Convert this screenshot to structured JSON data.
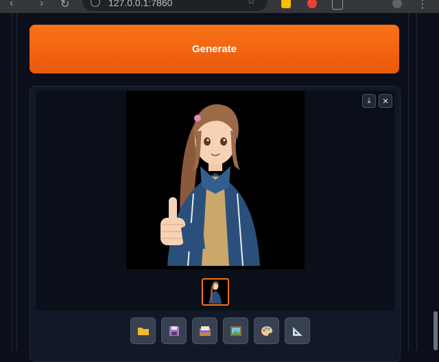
{
  "browser": {
    "url": "127.0.0.1:7860"
  },
  "app": {
    "generate_label": "Generate"
  },
  "gallery": {
    "download_icon": "download-icon",
    "close_icon": "close-icon",
    "selected_thumbnail": 0
  },
  "toolbar": {
    "buttons": [
      {
        "icon": "folder-icon"
      },
      {
        "icon": "floppy-disk-icon"
      },
      {
        "icon": "card-index-icon"
      },
      {
        "icon": "framed-picture-icon"
      },
      {
        "icon": "palette-icon"
      },
      {
        "icon": "triangular-ruler-icon"
      }
    ]
  },
  "colors": {
    "accent": "#f97316",
    "background": "#0b0f19",
    "panel": "#111827"
  }
}
